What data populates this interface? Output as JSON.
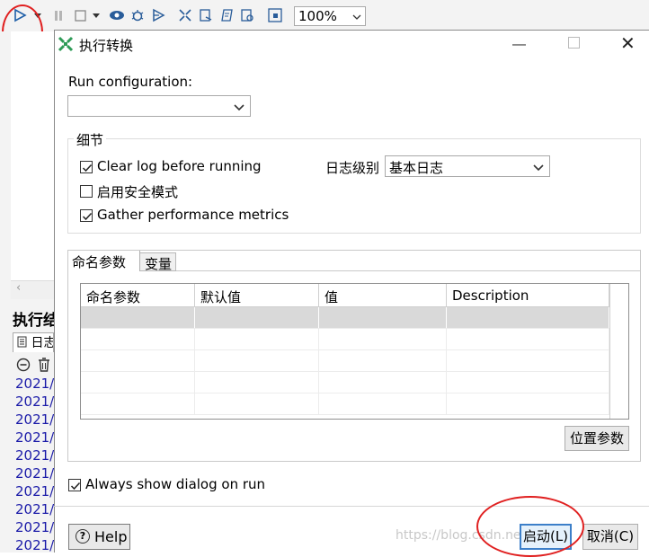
{
  "app": {
    "toolbar": {
      "zoom_value": "100%",
      "icons": [
        "run-icon",
        "dropdown-icon",
        "pause-icon",
        "stop-icon",
        "preview-icon",
        "debug-icon",
        "replay-icon",
        "verify-icon",
        "impact-icon",
        "sql-icon",
        "explore-db-icon",
        "show-results-icon"
      ]
    },
    "left_panel": {
      "exec_title": "执行结",
      "log_tab": "日志",
      "log_lines": [
        "2021/",
        "2021/",
        "2021/",
        "2021/",
        "2021/",
        "2021/",
        "2021/",
        "2021/",
        "2021/",
        "2021/"
      ]
    }
  },
  "dialog": {
    "title": "执行转换",
    "run_configuration": {
      "label": "Run configuration:",
      "value": ""
    },
    "details": {
      "legend": "细节",
      "clear_log": {
        "label": "Clear log before running",
        "checked": true
      },
      "safe_mode": {
        "label": "启用安全模式",
        "checked": false
      },
      "gather_metrics": {
        "label": "Gather performance metrics",
        "checked": true
      },
      "log_level_label": "日志级别",
      "log_level_value": "基本日志"
    },
    "tabs": {
      "params_tab": "命名参数",
      "vars_tab": "变量"
    },
    "params_table": {
      "columns": [
        "命名参数",
        "默认值",
        "值",
        "Description"
      ],
      "rows": [
        [
          "",
          "",
          "",
          ""
        ],
        [
          "",
          "",
          "",
          ""
        ],
        [
          "",
          "",
          "",
          ""
        ],
        [
          "",
          "",
          "",
          ""
        ],
        [
          "",
          "",
          "",
          ""
        ]
      ]
    },
    "position_params_button": "位置参数",
    "always_show": {
      "label": "Always show dialog on run",
      "checked": true
    },
    "help_button": "Help",
    "start_button": "启动(L)",
    "cancel_button": "取消(C)"
  },
  "watermark": "https://blog.csdn.net/..."
}
